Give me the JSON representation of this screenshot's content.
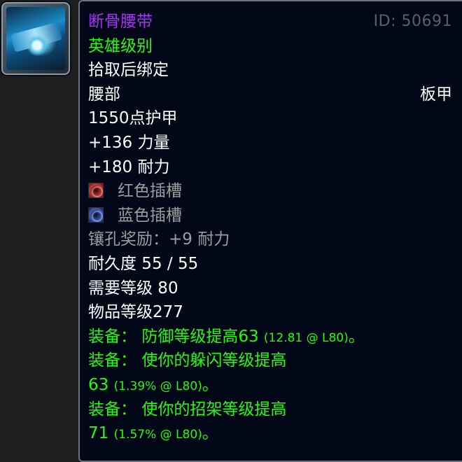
{
  "item": {
    "name": "断骨腰带",
    "id_text": "ID: 50691",
    "quality": "英雄级别",
    "binding": "拾取后绑定",
    "slot": "腰部",
    "armor_type": "板甲",
    "armor": "1550点护甲",
    "stats": [
      "+136 力量",
      "+180 耐力"
    ],
    "sockets": [
      {
        "color": "red",
        "label": "红色插槽"
      },
      {
        "color": "blue",
        "label": "蓝色插槽"
      }
    ],
    "socket_bonus": "镶孔奖励：+9 耐力",
    "durability": "耐久度 55 / 55",
    "required_level": "需要等级 80",
    "item_level": "物品等级277",
    "equips": [
      {
        "prefix": "装备：",
        "text": "防御等级提高63",
        "detail": "(12.81 @ L80)",
        "suffix": "。"
      },
      {
        "prefix": "装备：",
        "text": "使你的躲闪等级提高",
        "value": "63",
        "detail": "(1.39% @ L80)",
        "suffix": "。"
      },
      {
        "prefix": "装备：",
        "text": "使你的招架等级提高",
        "value": "71",
        "detail": "(1.57% @ L80)",
        "suffix": "。"
      }
    ]
  },
  "icon": "plate-belt-icon",
  "colors": {
    "epic": "#a335ee",
    "uncommon": "#1eff00",
    "gray": "#9d9d9d",
    "background": "#030818"
  }
}
